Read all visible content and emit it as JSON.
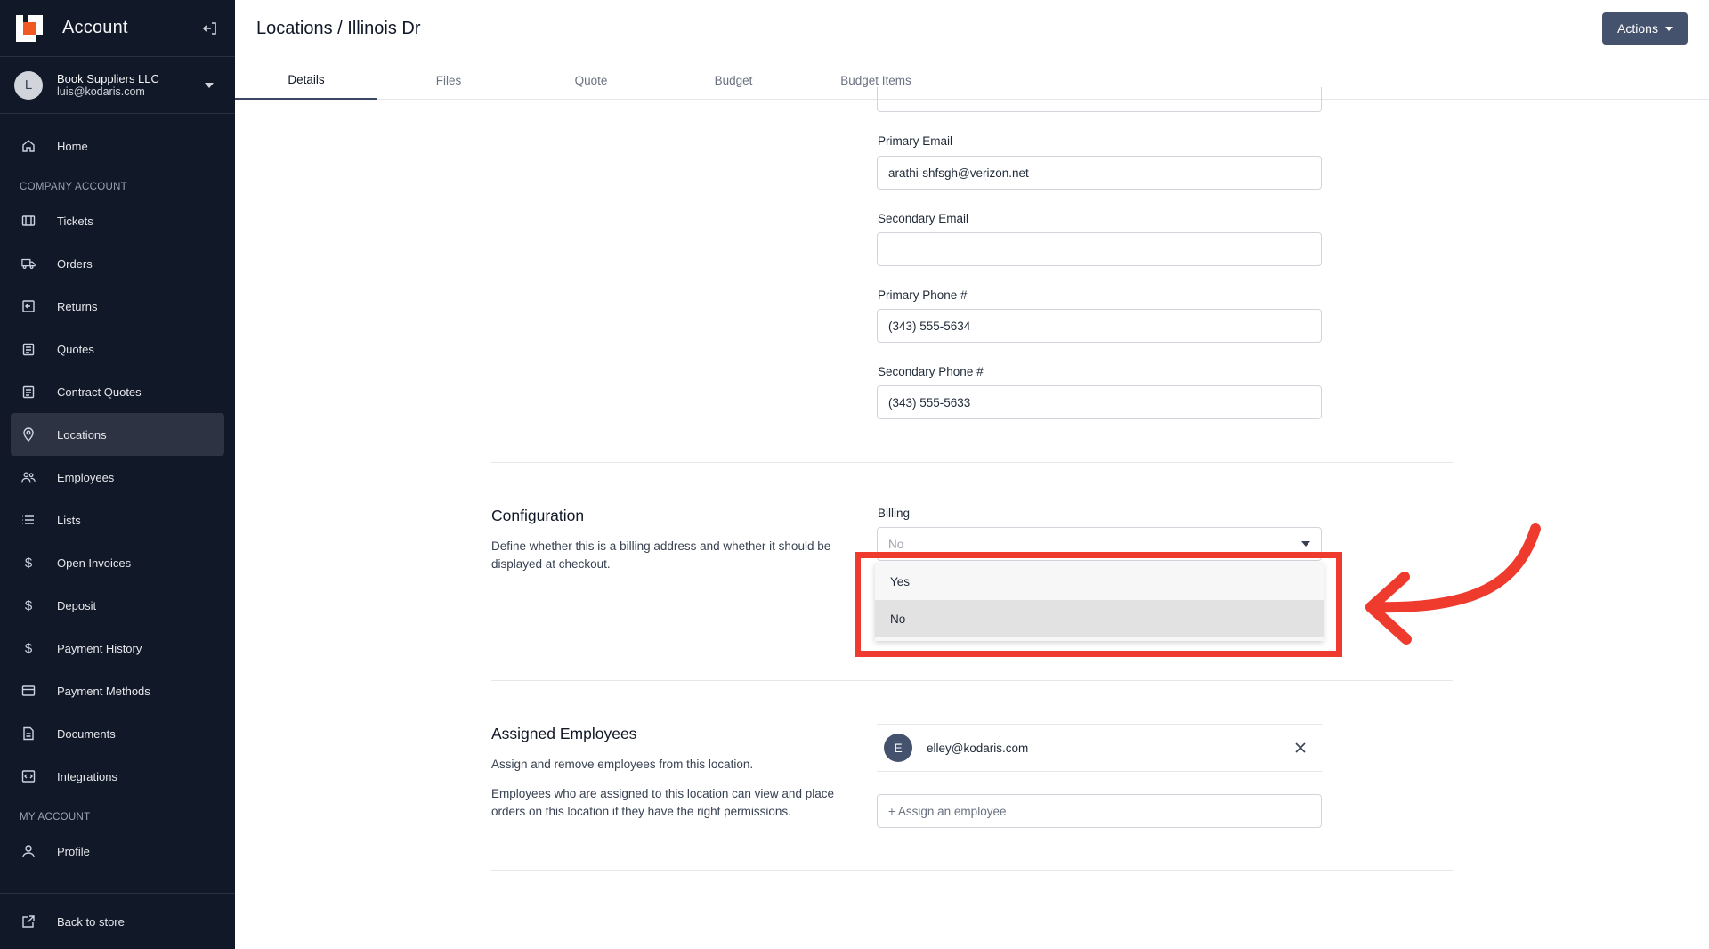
{
  "sidebar": {
    "title": "Account",
    "account": {
      "initial": "L",
      "name": "Book Suppliers LLC",
      "email": "luis@kodaris.com"
    },
    "home": "Home",
    "section_company": "COMPANY ACCOUNT",
    "items": [
      {
        "label": "Tickets",
        "icon": "ticket-icon"
      },
      {
        "label": "Orders",
        "icon": "truck-icon"
      },
      {
        "label": "Returns",
        "icon": "return-icon"
      },
      {
        "label": "Quotes",
        "icon": "clipboard-icon"
      },
      {
        "label": "Contract Quotes",
        "icon": "clipboard-icon"
      },
      {
        "label": "Locations",
        "icon": "map-pin-icon",
        "active": true
      },
      {
        "label": "Employees",
        "icon": "users-icon"
      },
      {
        "label": "Lists",
        "icon": "list-icon"
      },
      {
        "label": "Open Invoices",
        "icon": "dollar-icon"
      },
      {
        "label": "Deposit",
        "icon": "dollar-icon"
      },
      {
        "label": "Payment History",
        "icon": "dollar-icon"
      },
      {
        "label": "Payment Methods",
        "icon": "credit-card-icon"
      },
      {
        "label": "Documents",
        "icon": "document-icon"
      },
      {
        "label": "Integrations",
        "icon": "code-icon"
      }
    ],
    "section_my": "MY ACCOUNT",
    "profile": "Profile",
    "back": "Back to store"
  },
  "header": {
    "title": "Locations / Illinois Dr",
    "actions_label": "Actions",
    "tabs": [
      "Details",
      "Files",
      "Quote",
      "Budget",
      "Budget Items"
    ],
    "active_tab": "Details"
  },
  "contact": {
    "primary_email_label": "Primary Email",
    "primary_email_value": "arathi-shfsgh@verizon.net",
    "secondary_email_label": "Secondary Email",
    "secondary_email_value": "",
    "primary_phone_label": "Primary Phone #",
    "primary_phone_value": "(343) 555-5634",
    "secondary_phone_label": "Secondary Phone #",
    "secondary_phone_value": "(343) 555-5633"
  },
  "configuration": {
    "title": "Configuration",
    "description": "Define whether this is a billing address and whether it should be displayed at checkout.",
    "billing_label": "Billing",
    "billing_value": "No",
    "options": [
      "Yes",
      "No"
    ],
    "highlight_color": "#ef3b2d"
  },
  "employees": {
    "title": "Assigned Employees",
    "desc1": "Assign and remove employees from this location.",
    "desc2": "Employees who are assigned to this location can view and place orders on this location if they have the right permissions.",
    "assigned": [
      {
        "initial": "E",
        "email": "elley@kodaris.com"
      }
    ],
    "assign_placeholder": "+ Assign an employee"
  },
  "colors": {
    "sidebar_bg": "#111827",
    "accent": "#45526e",
    "annotation": "#ef3b2d"
  }
}
